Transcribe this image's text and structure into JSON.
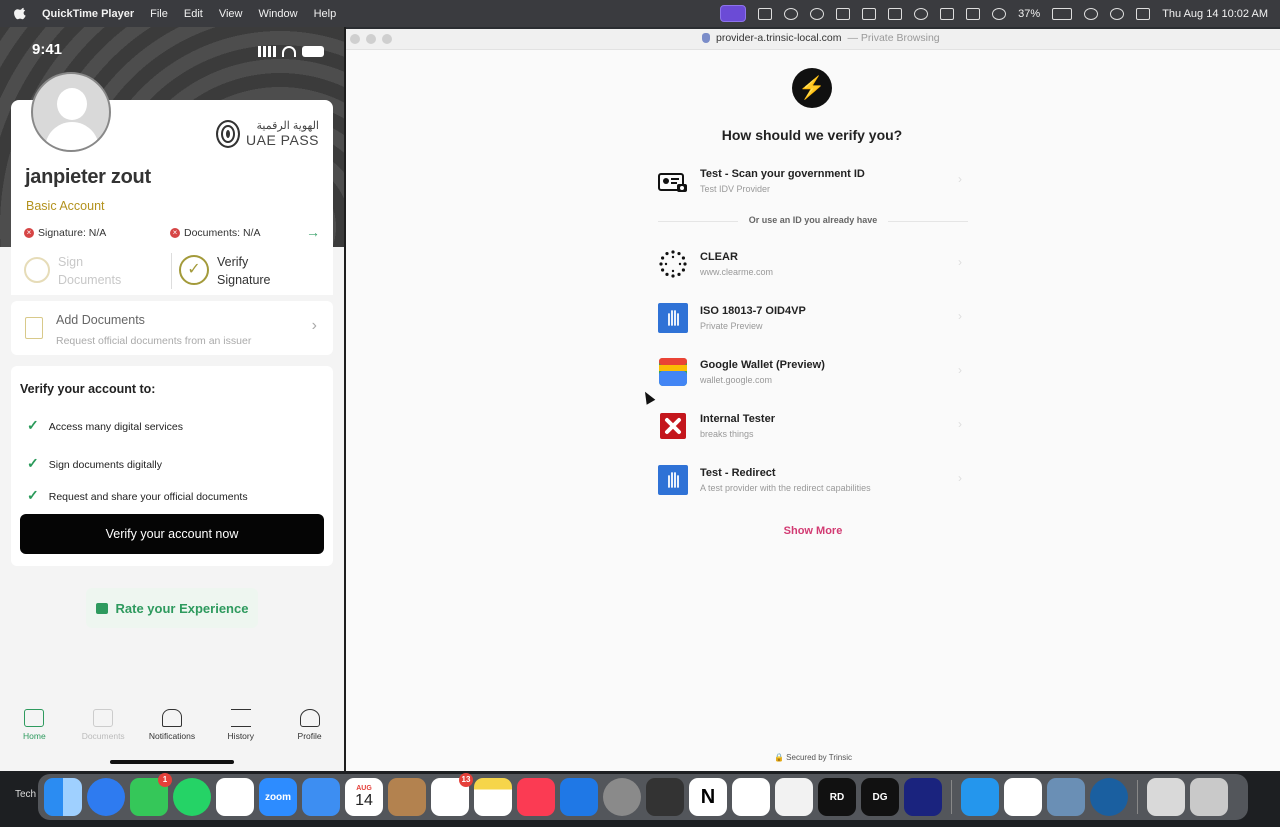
{
  "menubar": {
    "app_name": "QuickTime Player",
    "menus": [
      "File",
      "Edit",
      "View",
      "Window",
      "Help"
    ],
    "battery": "37%",
    "clock": "Thu Aug 14  10:02 AM"
  },
  "phone": {
    "time": "9:41",
    "brand_arabic": "الهوية الرقمية",
    "brand_latin": "UAE PASS",
    "user_name": "janpieter zout",
    "account_type": "Basic Account",
    "signature_status": "Signature: N/A",
    "documents_status": "Documents: N/A",
    "sign_line1": "Sign",
    "sign_line2": "Documents",
    "verify_line1": "Verify",
    "verify_line2": "Signature",
    "add_docs_title": "Add Documents",
    "add_docs_sub": "Request official documents from an issuer",
    "verify_title": "Verify your account to:",
    "benefits": [
      "Access many digital services",
      "Sign documents digitally",
      "Request and share your official documents"
    ],
    "verify_button": "Verify your account now",
    "rate_button": "Rate your Experience",
    "tabs": [
      "Home",
      "Documents",
      "Notifications",
      "History",
      "Profile"
    ]
  },
  "browser": {
    "url": "provider-a.trinsic-local.com",
    "private_label": "— Private Browsing",
    "heading": "How should we verify you?",
    "primary_provider": {
      "name": "Test - Scan your government ID",
      "sub": "Test IDV Provider"
    },
    "divider_text": "Or use an ID you already have",
    "providers": [
      {
        "name": "CLEAR",
        "sub": "www.clearme.com"
      },
      {
        "name": "ISO 18013-7 OID4VP",
        "sub": "Private Preview"
      },
      {
        "name": "Google Wallet (Preview)",
        "sub": "wallet.google.com"
      },
      {
        "name": "Internal Tester",
        "sub": "breaks things"
      },
      {
        "name": "Test - Redirect",
        "sub": "A test provider with the redirect capabilities"
      }
    ],
    "show_more": "Show More",
    "secured_by": "🔒 Secured by Trinsic"
  },
  "dock": {
    "left_label": "Tech",
    "calendar_month": "AUG",
    "calendar_day": "14",
    "messages_badge": "1",
    "reminders_badge": "13",
    "zoom_label": "zoom"
  },
  "colors": {
    "accent_green": "#2e9a5e",
    "accent_pink": "#d23a72",
    "gold": "#b3921e"
  }
}
